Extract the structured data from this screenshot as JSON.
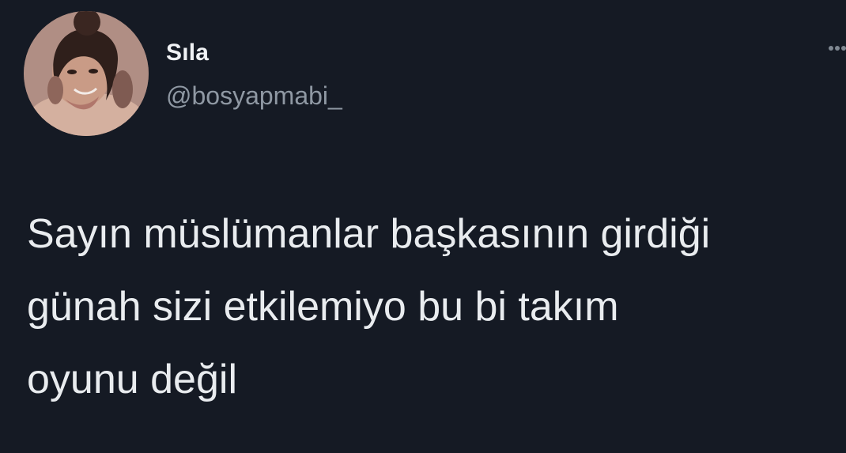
{
  "tweet": {
    "author_name": "Sıla",
    "author_handle": "@bosyapmabi_",
    "text": "Sayın müslümanlar başkasının girdiği\ngünah sizi etkilemiyo bu bi takım\noyunu değil"
  },
  "icons": {
    "avatar": "profile-photo",
    "more": "more-options-icon"
  },
  "colors": {
    "background": "#151a24",
    "name": "#f0f2f5",
    "handle": "#8f98a3",
    "text": "#e9ecef"
  }
}
